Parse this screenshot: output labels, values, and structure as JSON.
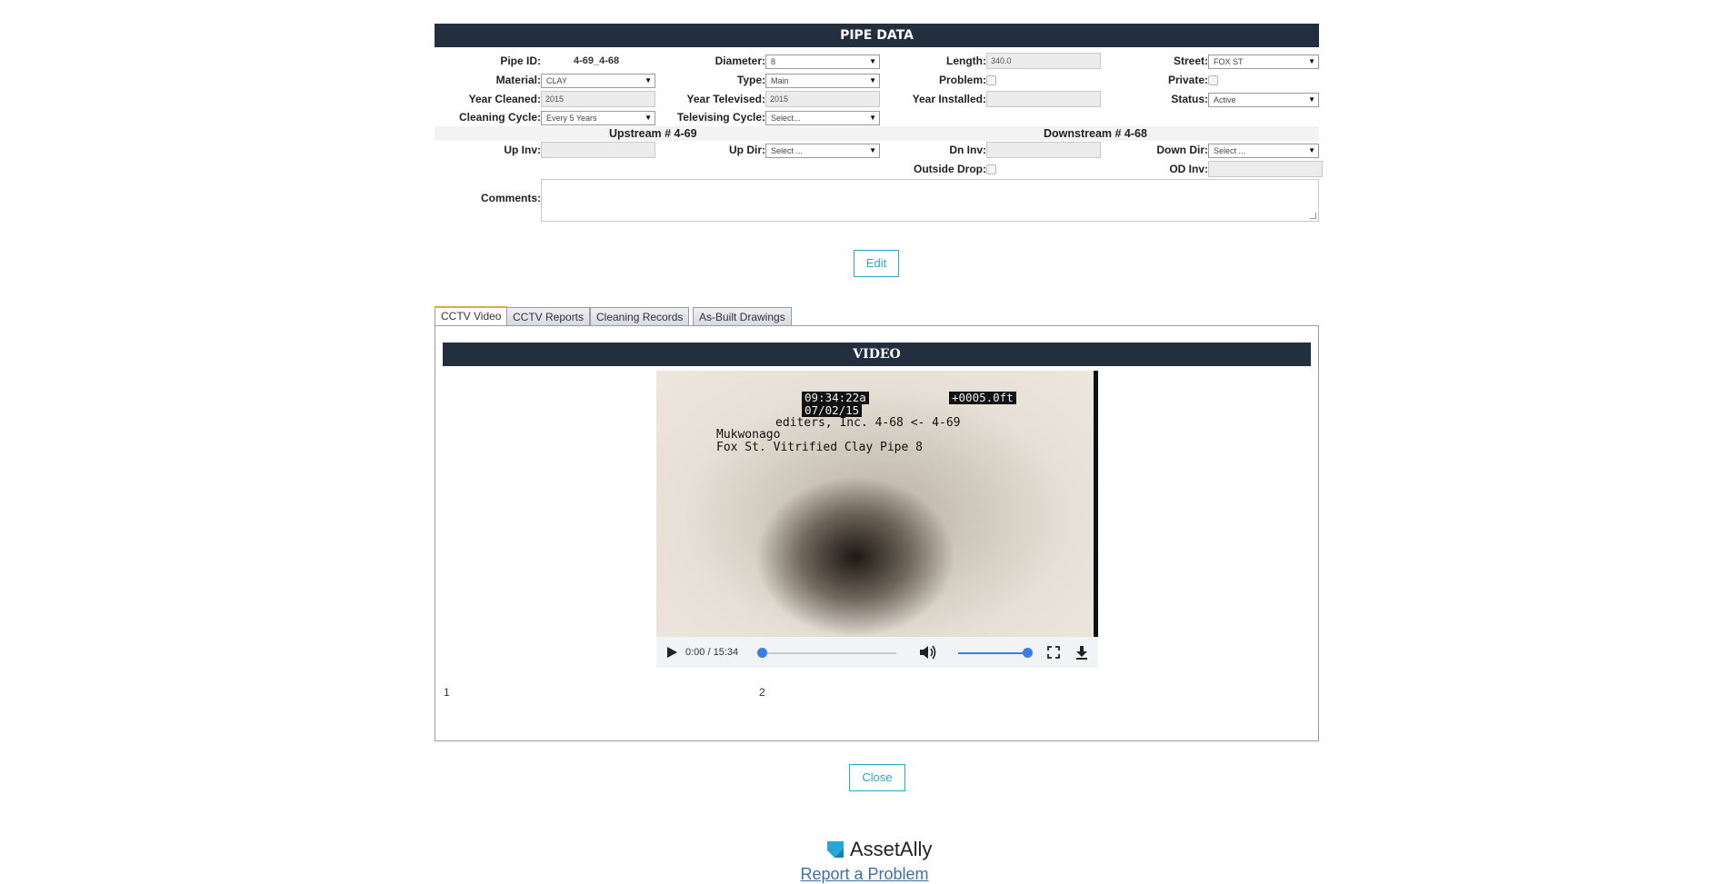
{
  "pipe": {
    "title": "PIPE DATA",
    "pipe_id_label": "Pipe ID:",
    "pipe_id_value": "4-69_4-68",
    "diameter_label": "Diameter:",
    "diameter_value": "8",
    "length_label": "Length:",
    "length_value": "340.0",
    "street_label": "Street:",
    "street_value": "FOX ST",
    "material_label": "Material:",
    "material_value": "CLAY",
    "type_label": "Type:",
    "type_value": "Main",
    "problem_label": "Problem:",
    "private_label": "Private:",
    "year_cleaned_label": "Year Cleaned:",
    "year_cleaned_value": "2015",
    "year_televised_label": "Year Televised:",
    "year_televised_value": "2015",
    "year_installed_label": "Year Installed:",
    "year_installed_value": "",
    "status_label": "Status:",
    "status_value": "Active",
    "cleaning_cycle_label": "Cleaning Cycle:",
    "cleaning_cycle_value": "Every 5 Years",
    "televising_cycle_label": "Televising Cycle:",
    "televising_cycle_value": "Select...",
    "upstream_label": "Upstream # 4-69",
    "downstream_label": "Downstream # 4-68",
    "up_inv_label": "Up Inv:",
    "up_dir_label": "Up Dir:",
    "up_dir_value": "Select ...",
    "dn_inv_label": "Dn Inv:",
    "down_dir_label": "Down Dir:",
    "down_dir_value": "Select ...",
    "outside_drop_label": "Outside Drop:",
    "od_inv_label": "OD Inv:",
    "comments_label": "Comments:",
    "edit_label": "Edit"
  },
  "tabs": [
    "CCTV Video",
    "CCTV Reports",
    "Cleaning Records",
    "As-Built Drawings"
  ],
  "video": {
    "title": "VIDEO",
    "overlay_time": "09:34:22a",
    "overlay_date": "07/02/15",
    "overlay_distance": "+0005.0ft",
    "overlay_line1": "editers, Inc. 4-68 <- 4-69",
    "overlay_line2": "Mukwonago",
    "overlay_line3": "Fox St. Vitrified Clay Pipe 8",
    "time_display": "0:00 / 15:34",
    "playback_progress": 0,
    "volume_level": 1.0
  },
  "pagination": [
    "1",
    "2"
  ],
  "close_label": "Close",
  "footer": {
    "logo_text": "AssetAlly",
    "report_link": "Report a Problem"
  }
}
